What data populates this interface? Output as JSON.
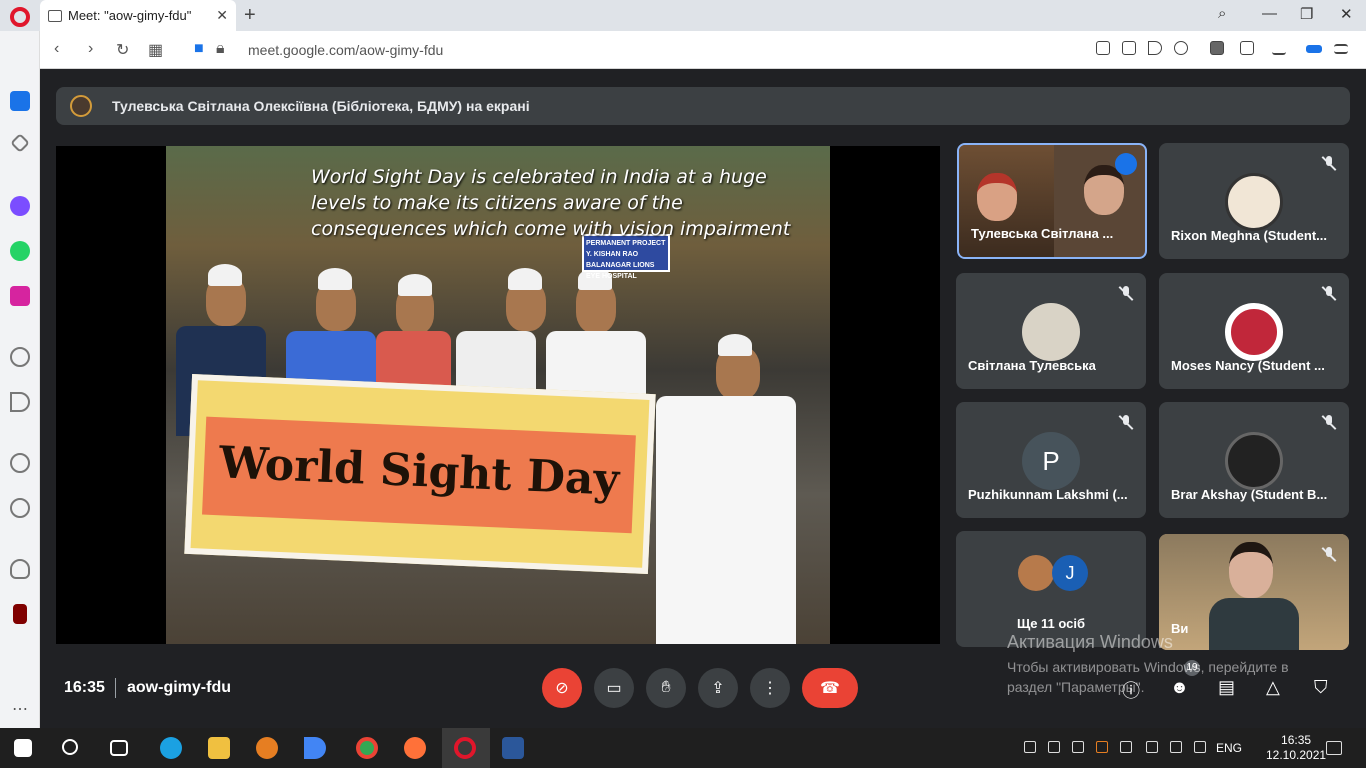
{
  "browser": {
    "tab_title": "Meet: \"aow-gimy-fdu\"",
    "url": "meet.google.com/aow-gimy-fdu"
  },
  "meet": {
    "presenting_banner": "Тулевська Світлана Олексіївна (Бібліотека, БДМУ) на екрані",
    "slide": {
      "caption": "World Sight Day is celebrated in India at a huge levels to make its citizens aware of the consequences which come with vision impairment",
      "banner_text": "World Sight Day",
      "sign_text": "PERMANENT PROJECT Y. KISHAN RAO BALANAGAR LIONS EYE HOSPITAL"
    },
    "participants": [
      {
        "name": "Тулевська Світлана ...",
        "type": "video",
        "speaking": true
      },
      {
        "name": "Rixon Meghna (Student...",
        "type": "photo",
        "muted": true
      },
      {
        "name": "Світлана Тулевська",
        "type": "photo",
        "muted": true
      },
      {
        "name": "Moses Nancy (Student ...",
        "type": "photo",
        "muted": true
      },
      {
        "name": "Puzhikunnam Lakshmi (...",
        "type": "letter",
        "letter": "P",
        "muted": true
      },
      {
        "name": "Brar Akshay (Student B...",
        "type": "photo",
        "muted": true
      },
      {
        "name": "Ще 11 осіб",
        "type": "others",
        "letter": "J"
      },
      {
        "name": "Ви",
        "type": "video",
        "muted": true
      }
    ],
    "bottom": {
      "time": "16:35",
      "meeting_code": "aow-gimy-fdu",
      "people_count": "19"
    }
  },
  "windows_watermark": {
    "title": "Активация Windows",
    "text": "Чтобы активировать Windows, перейдите в раздел \"Параметры\"."
  },
  "taskbar": {
    "language": "ENG",
    "time": "16:35",
    "date": "12.10.2021"
  }
}
